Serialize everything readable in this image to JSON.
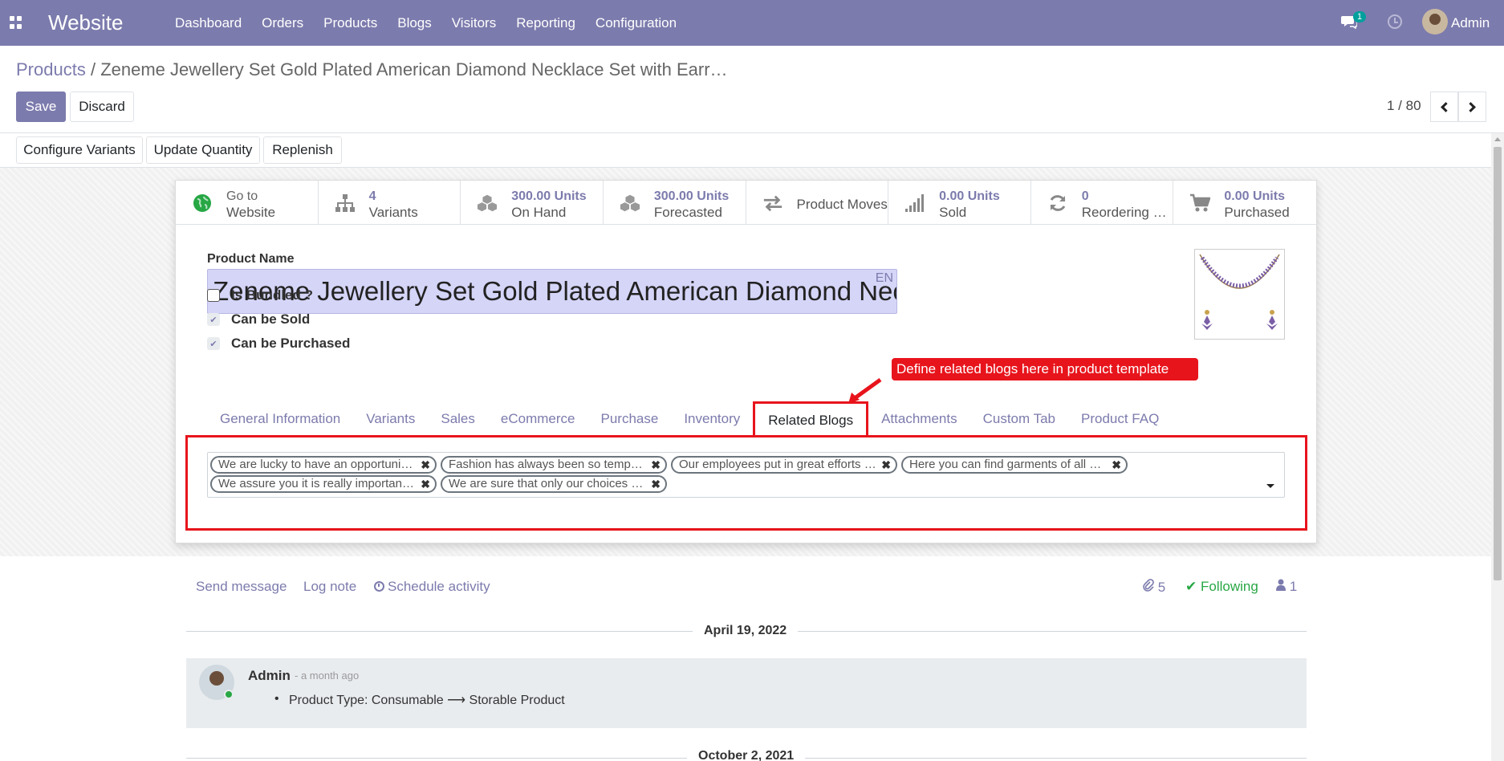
{
  "app": {
    "title": "Website"
  },
  "menu": [
    "Dashboard",
    "Orders",
    "Products",
    "Blogs",
    "Visitors",
    "Reporting",
    "Configuration"
  ],
  "systray": {
    "chat_count": "1",
    "user": "Admin"
  },
  "breadcrumb": {
    "parent": "Products",
    "separator": "/",
    "current": "Zeneme Jewellery Set Gold Plated American Diamond Necklace Set with Earr…"
  },
  "buttons": {
    "save": "Save",
    "discard": "Discard"
  },
  "pager": {
    "value": "1 / 80"
  },
  "actions": {
    "configure_variants": "Configure Variants",
    "update_quantity": "Update Quantity",
    "replenish": "Replenish"
  },
  "smart_buttons": [
    {
      "line1": "Go to",
      "line2": "Website",
      "icon": "globe-icon"
    },
    {
      "line1": "4",
      "line2": "Variants",
      "icon": "sitemap-icon"
    },
    {
      "line1": "300.00 Units",
      "line2": "On Hand",
      "icon": "cubes-icon"
    },
    {
      "line1": "300.00 Units",
      "line2": "Forecasted",
      "icon": "cubes-icon"
    },
    {
      "line1": "Product Moves",
      "icon": "exchange-icon"
    },
    {
      "line1": "0.00 Units",
      "line2": "Sold",
      "icon": "signal-icon"
    },
    {
      "line1": "0",
      "line2": "Reordering …",
      "icon": "refresh-icon"
    },
    {
      "line1": "0.00 Units",
      "line2": "Purchased",
      "icon": "cart-icon"
    }
  ],
  "form": {
    "product_name_label": "Product Name",
    "product_name_value": "Zeneme Jewellery Set Gold Plated American Diamond Necklace Set with Earrings",
    "lang": "EN",
    "is_bundled_label": "Is Bundled ?",
    "is_bundled": false,
    "can_be_sold_label": "Can be Sold",
    "can_be_sold": true,
    "can_be_purchased_label": "Can be Purchased",
    "can_be_purchased": true
  },
  "annotation": {
    "text": "Define related blogs here in product template",
    "color": "#e8141c"
  },
  "tabs": [
    "General Information",
    "Variants",
    "Sales",
    "eCommerce",
    "Purchase",
    "Inventory",
    "Related Blogs",
    "Attachments",
    "Custom Tab",
    "Product FAQ"
  ],
  "active_tab": "Related Blogs",
  "related_blogs": [
    "We are lucky to have an opportunit…",
    "Fashion has always been so temp…",
    "Our employees put in great efforts t…",
    "Here you can find garments of all s…",
    "We assure you it is really important…",
    "We are sure that only our choices …"
  ],
  "chatter": {
    "send_message": "Send message",
    "log_note": "Log note",
    "schedule_activity": "Schedule activity",
    "attachments_count": "5",
    "following": "Following",
    "followers_count": "1",
    "date1": "April 19, 2022",
    "message": {
      "author": "Admin",
      "time": "- a month ago",
      "change": "Product Type: Consumable ⟶ Storable Product"
    },
    "date2": "October 2, 2021"
  },
  "colors": {
    "brand": "#7c7bad",
    "highlight": "#e8141c",
    "success": "#28a745"
  }
}
